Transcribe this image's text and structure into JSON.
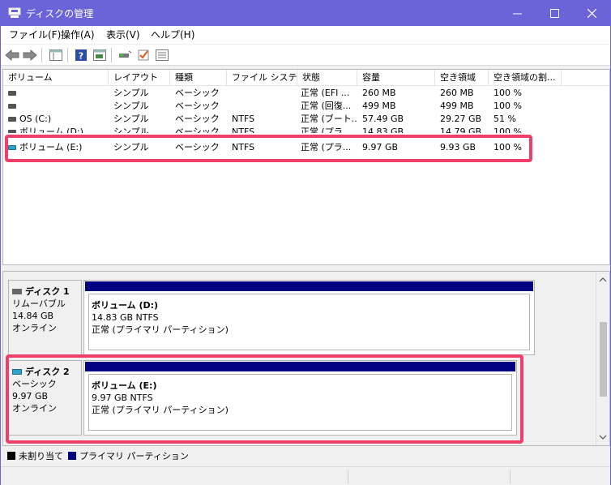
{
  "window": {
    "title": "ディスクの管理",
    "minimize": "minimize",
    "maximize": "maximize",
    "close": "close"
  },
  "menu": {
    "items": [
      "ファイル(F)",
      "操作(A)",
      "表示(V)",
      "ヘルプ(H)"
    ]
  },
  "table": {
    "headers": [
      "ボリューム",
      "レイアウト",
      "種類",
      "ファイル システム",
      "状態",
      "容量",
      "空き領域",
      "空き領域の割..."
    ],
    "rows": [
      {
        "volume": "",
        "layout": "シンプル",
        "type": "ベーシック",
        "fs": "",
        "status": "正常 (EFI ...",
        "capacity": "260 MB",
        "free": "260 MB",
        "pct": "100 %"
      },
      {
        "volume": "",
        "layout": "シンプル",
        "type": "ベーシック",
        "fs": "",
        "status": "正常 (回復...",
        "capacity": "499 MB",
        "free": "499 MB",
        "pct": "100 %"
      },
      {
        "volume": "OS (C:)",
        "layout": "シンプル",
        "type": "ベーシック",
        "fs": "NTFS",
        "status": "正常 (ブート...",
        "capacity": "57.49 GB",
        "free": "29.27 GB",
        "pct": "51 %"
      },
      {
        "volume": "ボリューム (D:)",
        "layout": "シンプル",
        "type": "ベーシック",
        "fs": "NTFS",
        "status": "正常 (プラ...",
        "capacity": "14.83 GB",
        "free": "14.79 GB",
        "pct": "100 %"
      },
      {
        "volume": "ボリューム (E:)",
        "layout": "シンプル",
        "type": "ベーシック",
        "fs": "NTFS",
        "status": "正常 (プラ...",
        "capacity": "9.97 GB",
        "free": "9.93 GB",
        "pct": "100 %"
      }
    ]
  },
  "disks": [
    {
      "name": "ディスク 1",
      "kind": "リムーバブル",
      "size": "14.84 GB",
      "state": "オンライン",
      "partition": {
        "name": "ボリューム (D:)",
        "size_fs": "14.83 GB NTFS",
        "status": "正常 (プライマリ パーティション)"
      }
    },
    {
      "name": "ディスク 2",
      "kind": "ベーシック",
      "size": "9.97 GB",
      "state": "オンライン",
      "partition": {
        "name": "ボリューム (E:)",
        "size_fs": "9.97 GB NTFS",
        "status": "正常 (プライマリ パーティション)"
      }
    }
  ],
  "legend": {
    "unallocated": "未割り当て",
    "primary": "プライマリ パーティション"
  },
  "colors": {
    "titlebar": "#6b63d8",
    "highlight": "#ef3f6a",
    "primary_partition": "#000080",
    "unallocated": "#000000"
  }
}
